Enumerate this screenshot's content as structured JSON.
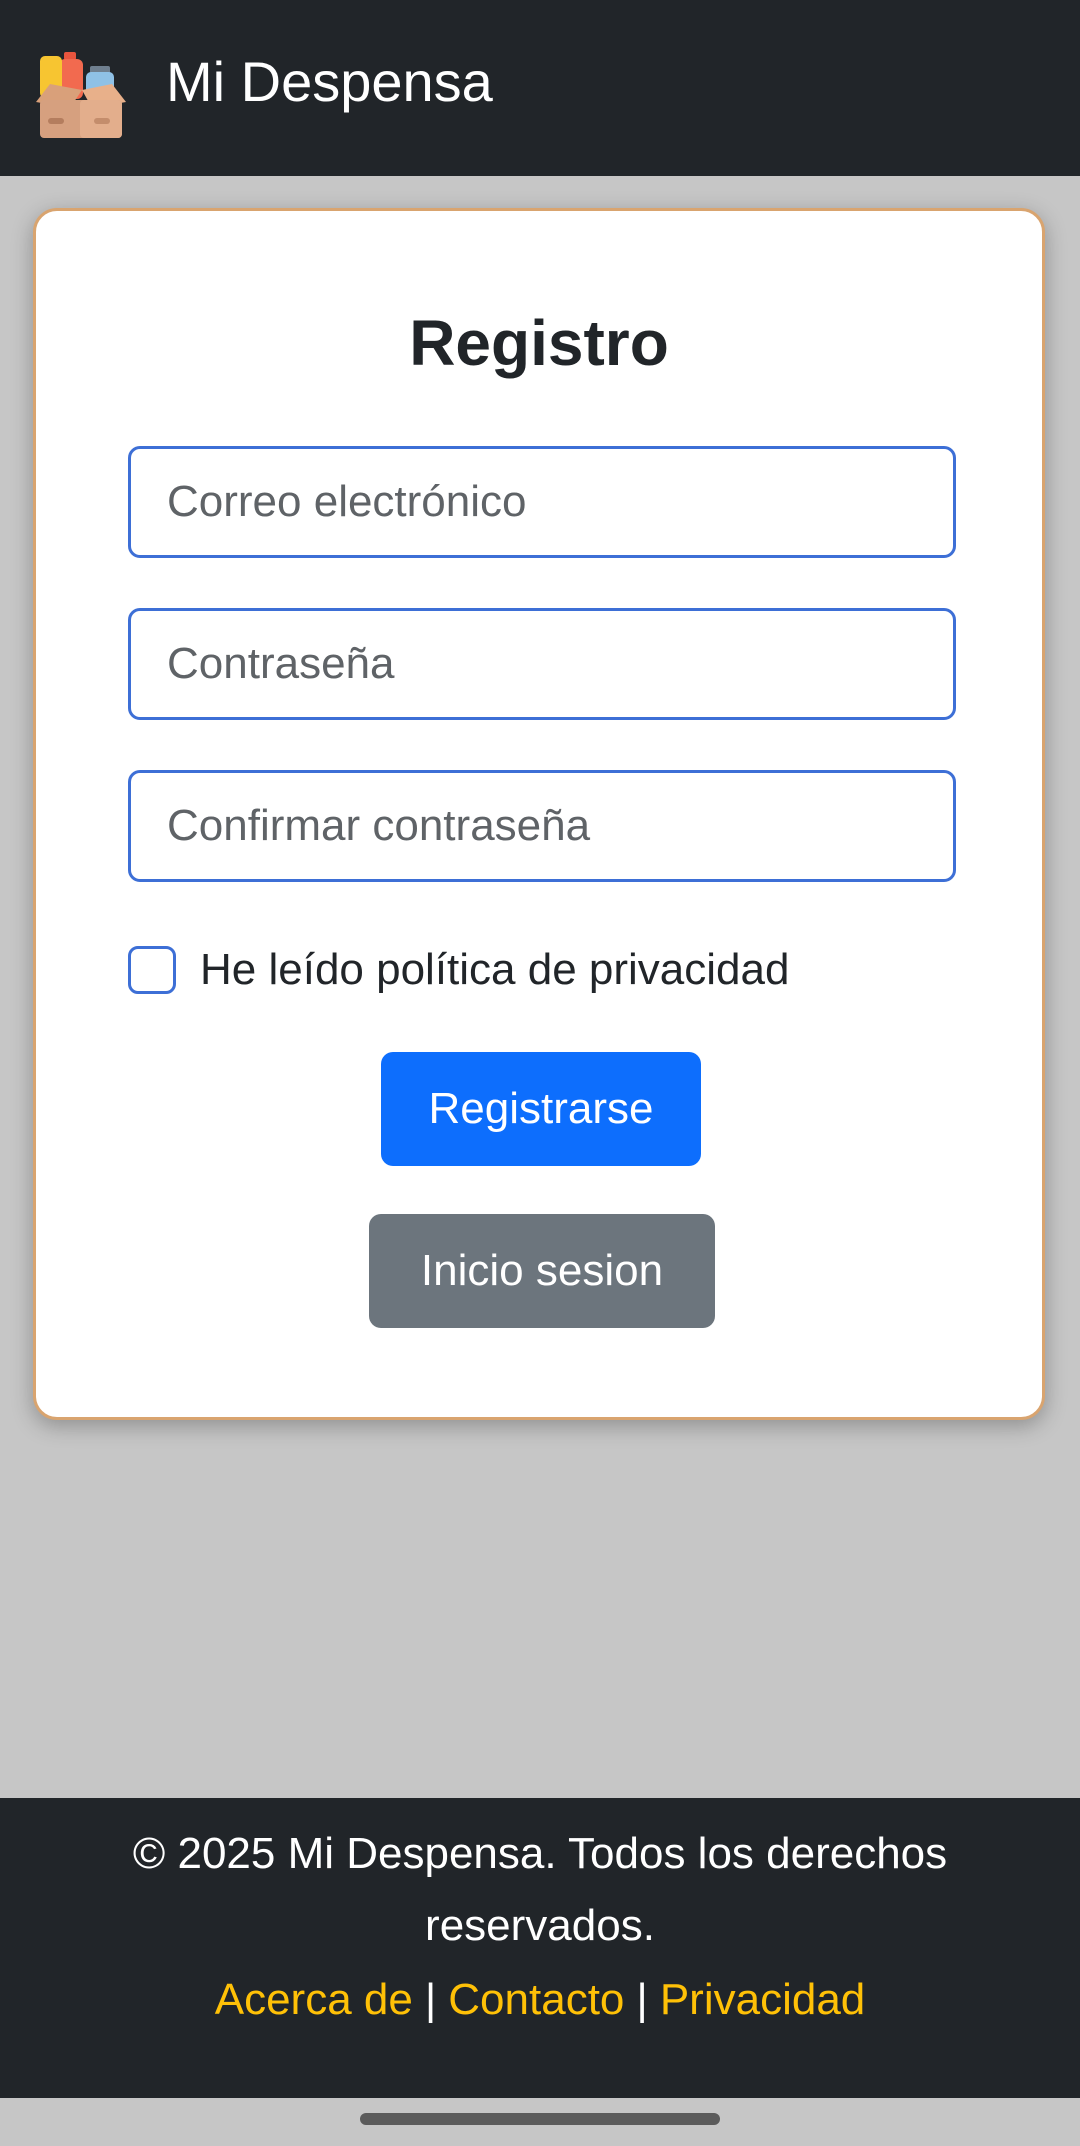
{
  "header": {
    "logo_icon": "pantry-box-icon",
    "title": "Mi Despensa"
  },
  "form": {
    "title": "Registro",
    "email_placeholder": "Correo electrónico",
    "password_placeholder": "Contraseña",
    "confirm_placeholder": "Confirmar contraseña",
    "privacy_label": "He leído política de privacidad",
    "privacy_checked": false,
    "register_label": "Registrarse",
    "login_label": "Inicio sesion"
  },
  "footer": {
    "copyright": "© 2025 Mi Despensa. Todos los derechos reservados.",
    "links": [
      "Acerca de",
      "Contacto",
      "Privacidad"
    ],
    "separator": "|"
  },
  "colors": {
    "header_bg": "#212529",
    "page_bg": "#c6c6c6",
    "card_border": "#d9a46f",
    "input_border": "#3d6fd6",
    "primary": "#0d6efd",
    "secondary": "#6c757d",
    "link": "#ffc107"
  }
}
